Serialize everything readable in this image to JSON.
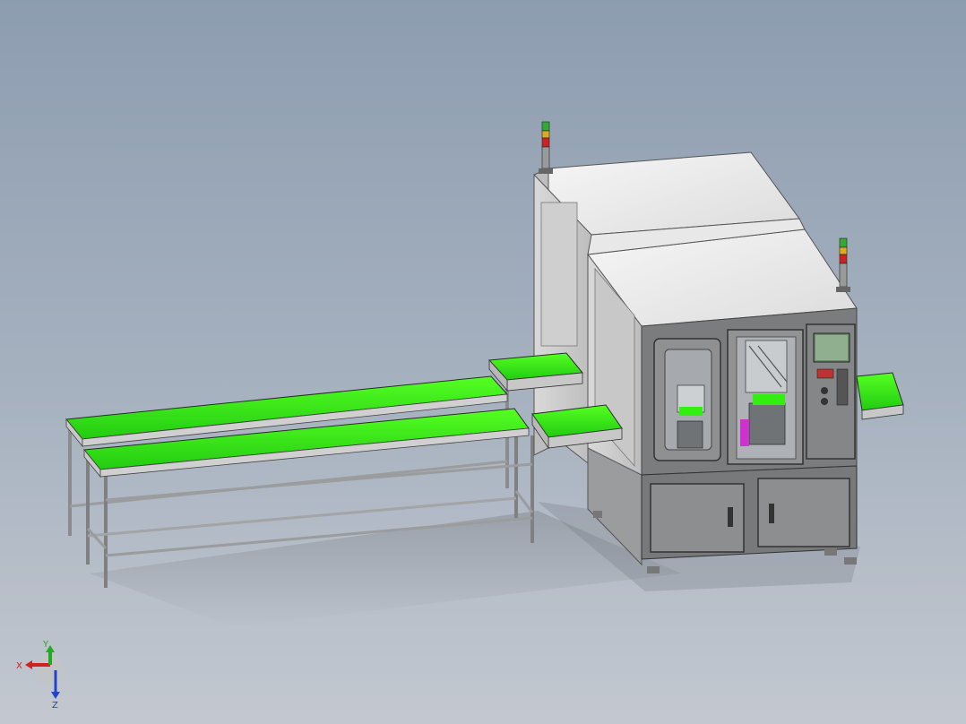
{
  "viewport": {
    "background_top": "#8d9db0",
    "background_bottom": "#c3c8d0"
  },
  "colors": {
    "conveyor_belt": "#33ee11",
    "machine_panel": "#e9e9e9",
    "machine_frame": "#6e7072",
    "pusher_magenta": "#cc33cc",
    "axis_x": "#cc2222",
    "axis_y": "#22aa22",
    "axis_z": "#2244cc"
  },
  "triad": {
    "x_label": "X",
    "y_label": "Y",
    "z_label": "Z",
    "icon": "coordinate-triad-icon"
  }
}
